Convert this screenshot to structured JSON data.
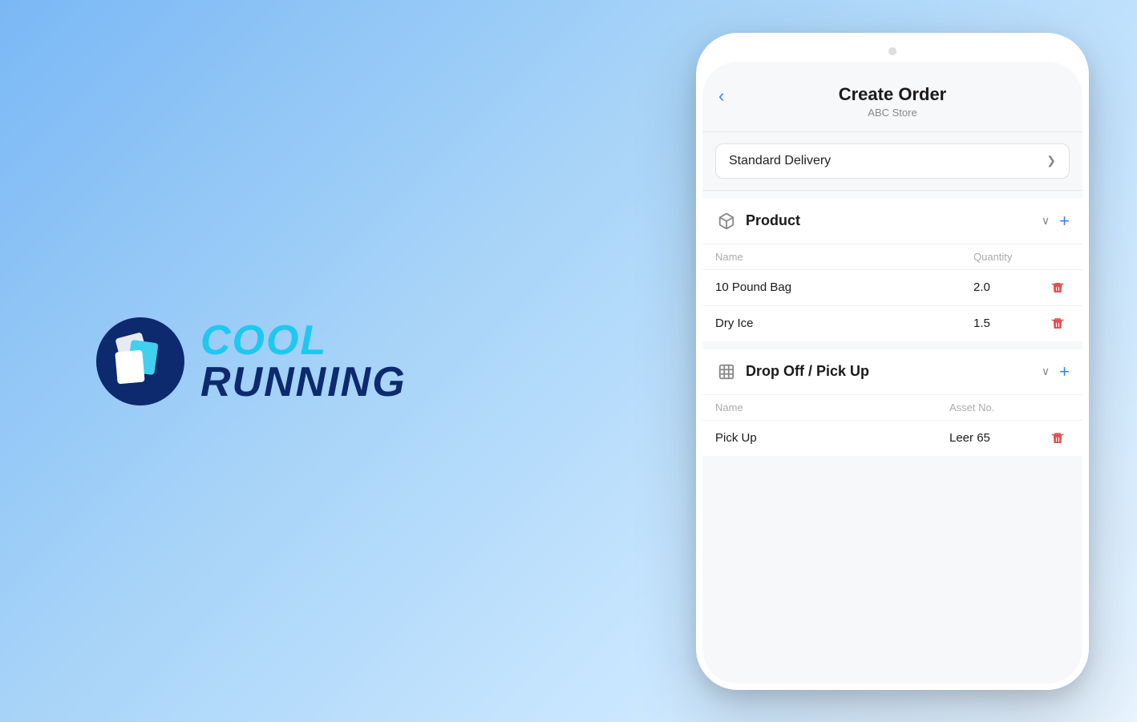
{
  "background": {
    "gradient_start": "#7ab8f5",
    "gradient_end": "#e8f4ff"
  },
  "logo": {
    "cool_text": "COOL",
    "running_text": "RUNNING"
  },
  "phone": {
    "header": {
      "back_label": "‹",
      "title": "Create Order",
      "subtitle": "ABC Store"
    },
    "delivery_dropdown": {
      "value": "Standard Delivery",
      "chevron": "❯"
    },
    "product_section": {
      "icon": "📦",
      "title": "Product",
      "chevron": "∨",
      "add_label": "+",
      "columns": {
        "name": "Name",
        "quantity": "Quantity"
      },
      "items": [
        {
          "name": "10 Pound Bag",
          "quantity": "2.0"
        },
        {
          "name": "Dry Ice",
          "quantity": "1.5"
        }
      ]
    },
    "dropoff_section": {
      "icon": "▦",
      "title": "Drop Off / Pick Up",
      "chevron": "∨",
      "add_label": "+",
      "columns": {
        "name": "Name",
        "asset_no": "Asset No."
      },
      "items": [
        {
          "name": "Pick Up",
          "asset_no": "Leer 65"
        }
      ]
    }
  }
}
